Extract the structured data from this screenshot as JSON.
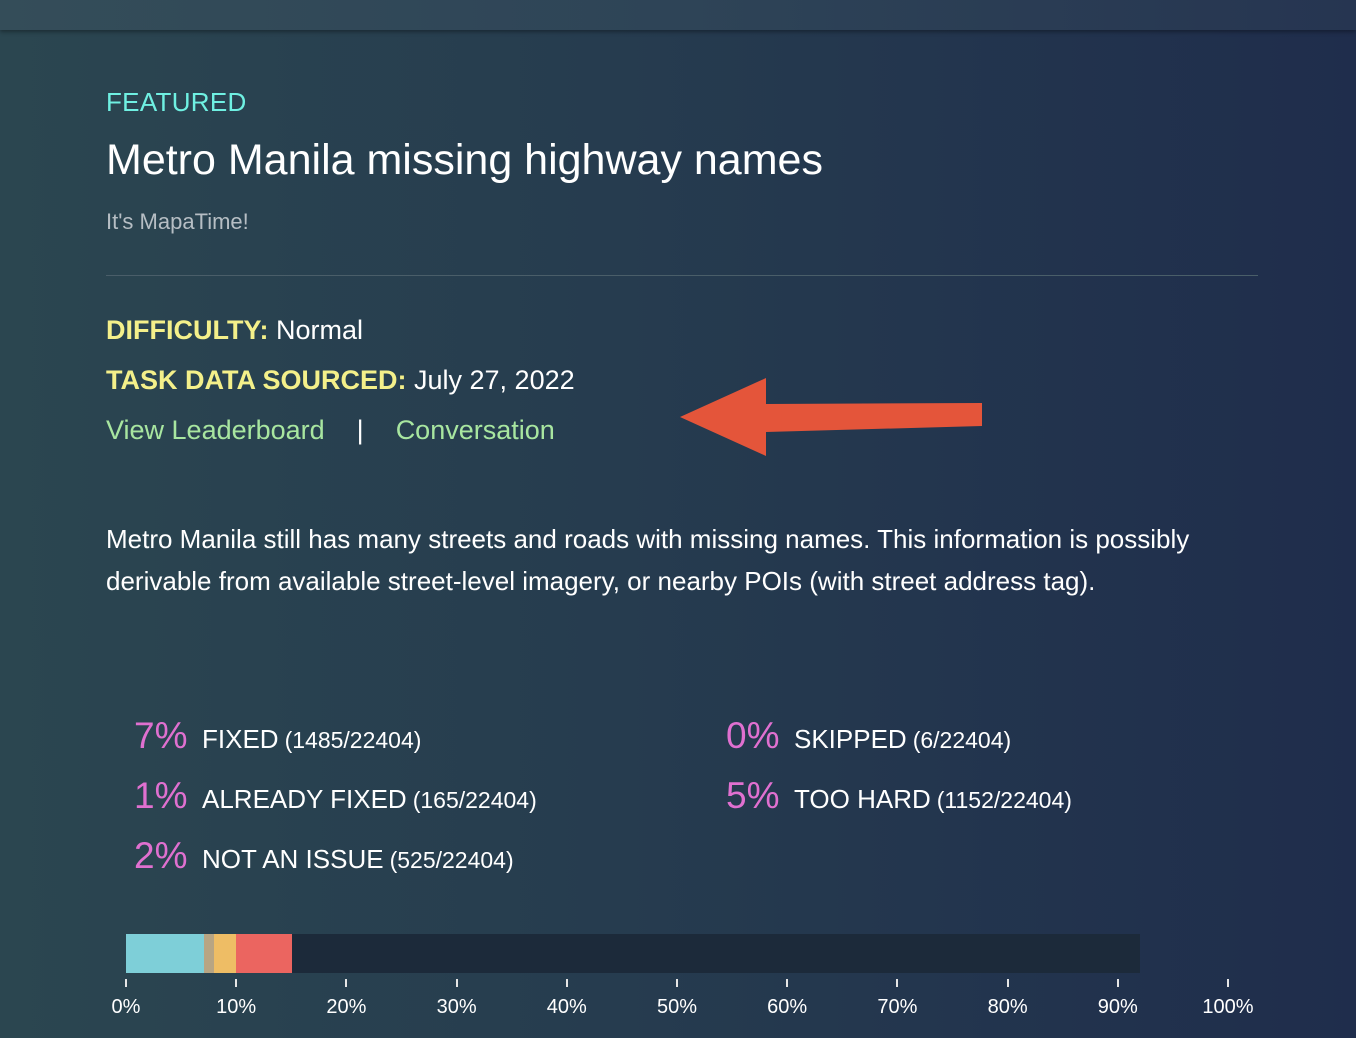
{
  "header": {
    "badge": "FEATURED",
    "title": "Metro Manila missing highway names",
    "subtitle": "It's MapaTime!"
  },
  "meta": {
    "difficulty_label": "DIFFICULTY:",
    "difficulty_value": "Normal",
    "sourced_label": "TASK DATA SOURCED:",
    "sourced_value": "July 27, 2022"
  },
  "links": {
    "leaderboard": "View Leaderboard",
    "separator": "|",
    "conversation": "Conversation"
  },
  "annotation": {
    "arrow_color": "#e4553a"
  },
  "description": "Metro Manila still has many streets and roads with missing names. This information is possibly derivable from available street-level imagery, or nearby POIs (with street address tag).",
  "stats": [
    {
      "pct": "7%",
      "name": "FIXED",
      "count": "(1485/22404)"
    },
    {
      "pct": "1%",
      "name": "ALREADY FIXED",
      "count": "(165/22404)"
    },
    {
      "pct": "2%",
      "name": "NOT AN ISSUE",
      "count": "(525/22404)"
    },
    {
      "pct": "0%",
      "name": "SKIPPED",
      "count": "(6/22404)"
    },
    {
      "pct": "5%",
      "name": "TOO HARD",
      "count": "(1152/22404)"
    }
  ],
  "progress": {
    "segments": [
      {
        "name": "fixed",
        "start_percent": 0,
        "end_percent": 7.1,
        "color": "#7ecfd8"
      },
      {
        "name": "already-fixed",
        "start_percent": 7.1,
        "end_percent": 8.0,
        "color": "#b8a583"
      },
      {
        "name": "not-an-issue",
        "start_percent": 8.0,
        "end_percent": 10.0,
        "color": "#eebd65"
      },
      {
        "name": "too-hard",
        "start_percent": 10.0,
        "end_percent": 15.1,
        "color": "#eb6560"
      }
    ],
    "track_end_percent": 92,
    "track_color": "#1c2a3a",
    "ticks": [
      "0%",
      "10%",
      "20%",
      "30%",
      "40%",
      "50%",
      "60%",
      "70%",
      "80%",
      "90%",
      "100%"
    ]
  }
}
